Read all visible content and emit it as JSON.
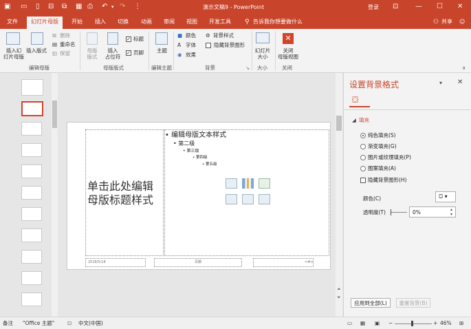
{
  "app": {
    "title": "演示文稿9  -  PowerPoint",
    "login": "登录"
  },
  "tabs": [
    "文件",
    "幻灯片母版",
    "开始",
    "插入",
    "切换",
    "动画",
    "审阅",
    "视图",
    "开发工具"
  ],
  "tell_me": "告诉我你想要做什么",
  "share": "共享",
  "ribbon": {
    "insert_master": "插入幻\n灯片母版",
    "insert_layout": "插入版式",
    "delete": "删除",
    "rename": "重命名",
    "preserve": "保留",
    "master_layout": "母版\n版式",
    "insert_placeholder": "插入\n占位符",
    "title_cb": "标题",
    "footer_cb": "页脚",
    "theme": "主题",
    "colors": "颜色",
    "fonts": "字体",
    "effects": "效果",
    "bg_styles": "背景样式",
    "hide_bg": "隐藏背景图形",
    "slide_size": "幻灯片\n大小",
    "close_master": "关闭\n母版视图",
    "groups": {
      "edit_master": "编辑母版",
      "master_layout": "母版版式",
      "edit_theme": "编辑主题",
      "background": "背景",
      "size": "大小",
      "close": "关闭"
    }
  },
  "slide": {
    "title_text": "单击此处编辑母版标题样式",
    "body_l1": "编辑母版文本样式",
    "body_l2": "第二级",
    "body_l3": "第三级",
    "body_l4": "第四级",
    "body_l5": "第五级",
    "date": "2018/5/18",
    "footer": "页脚",
    "page_num": "<#>"
  },
  "pane": {
    "title": "设置背景格式",
    "section": "填充",
    "options": [
      "纯色填充(S)",
      "渐变填充(G)",
      "图片或纹理填充(P)",
      "图案填充(A)"
    ],
    "selected_index": 0,
    "hide_bg": "隐藏背景图形(H)",
    "color_label": "颜色(C)",
    "transparency_label": "透明度(T)",
    "transparency_value": "0%",
    "apply_all": "应用到全部(L)",
    "reset": "重置背景(B)"
  },
  "status": {
    "notes": "备注",
    "theme": "\"Office 主题\"",
    "language": "中文(中国)",
    "zoom": "46%"
  },
  "colors": {
    "accent": "#c8442a"
  }
}
